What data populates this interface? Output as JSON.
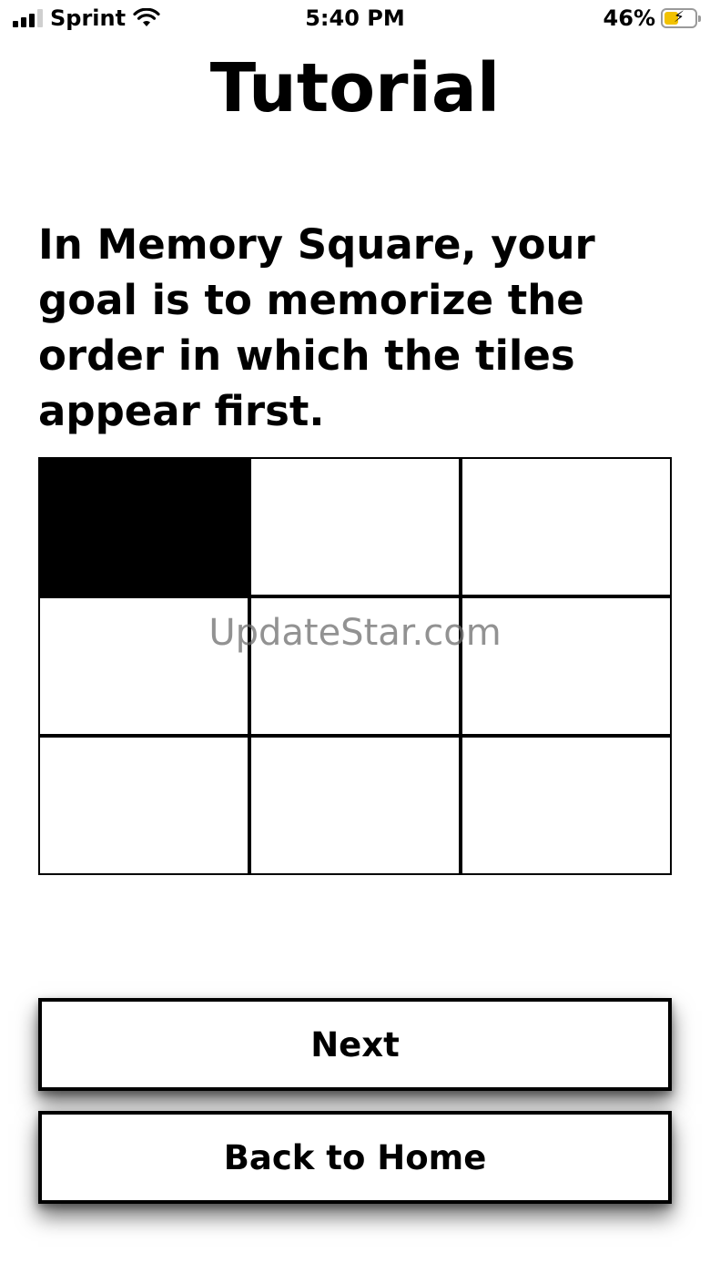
{
  "status_bar": {
    "carrier": "Sprint",
    "time": "5:40 PM",
    "battery_percent": "46%",
    "battery_level": 0.46,
    "battery_color": "#f2c200",
    "icons": [
      "cellular-signal-icon",
      "wifi-icon",
      "battery-charging-icon"
    ]
  },
  "page": {
    "title": "Tutorial",
    "instruction": "In Memory Square, your goal is to memorize the order in which the tiles appear first."
  },
  "grid": {
    "rows": 3,
    "columns": 3,
    "active_tiles": [
      0
    ]
  },
  "watermark": "UpdateStar.com",
  "buttons": {
    "next_label": "Next",
    "home_label": "Back to Home"
  }
}
